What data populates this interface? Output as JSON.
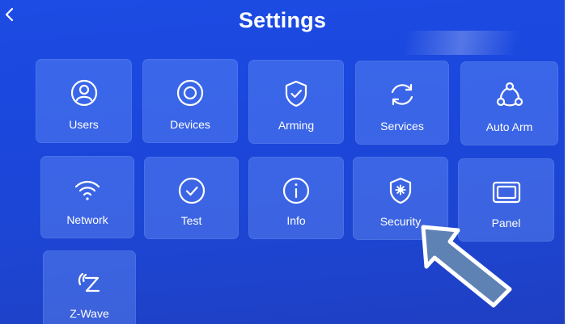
{
  "header": {
    "title": "Settings"
  },
  "tiles": [
    {
      "label": "Users",
      "icon": "users-icon"
    },
    {
      "label": "Devices",
      "icon": "devices-icon"
    },
    {
      "label": "Arming",
      "icon": "arming-shield-icon"
    },
    {
      "label": "Services",
      "icon": "services-sync-icon"
    },
    {
      "label": "Auto Arm",
      "icon": "auto-arm-icon"
    },
    {
      "label": "Network",
      "icon": "wifi-icon"
    },
    {
      "label": "Test",
      "icon": "check-circle-icon"
    },
    {
      "label": "Info",
      "icon": "info-icon"
    },
    {
      "label": "Security",
      "icon": "security-shield-gear-icon"
    },
    {
      "label": "Panel",
      "icon": "panel-icon"
    },
    {
      "label": "Z-Wave",
      "icon": "z-wave-icon"
    }
  ],
  "colors": {
    "background": "#1c4ce4",
    "tile": "#6f97f5",
    "text": "#ffffff",
    "arrow_fill": "#5f82b4"
  }
}
